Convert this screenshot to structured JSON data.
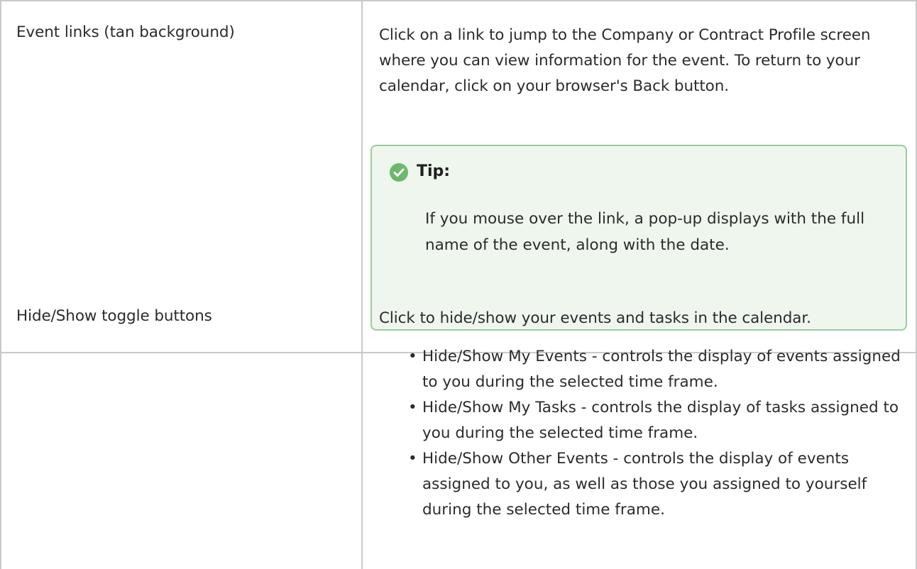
{
  "rows": [
    {
      "label": "Event links (tan background)",
      "description": "Click on a link to jump to the Company or Contract Profile screen where you can view information for the event. To return to your calendar, click on your browser's Back button.",
      "tip": {
        "title": "Tip:",
        "text": "If you mouse over the link, a pop-up displays with the full name of the event, along with the date."
      }
    },
    {
      "label": "Hide/Show toggle buttons",
      "description": "Click to hide/show your events and tasks in the calendar.",
      "bullets": [
        "Hide/Show My Events - controls the display of events assigned to you during the selected time frame.",
        "Hide/Show My Tasks - controls the display of tasks assigned to you during the selected time frame.",
        "Hide/Show Other Events - controls the display of events assigned to you, as well as those you assigned to yourself during the selected time frame."
      ]
    }
  ],
  "colors": {
    "border": "#c9c9c9",
    "tip_background": "#eef6ee",
    "tip_border": "#9dcb9d",
    "tip_icon": "#6db86d"
  },
  "icons": {
    "tip": "check-circle-icon"
  }
}
